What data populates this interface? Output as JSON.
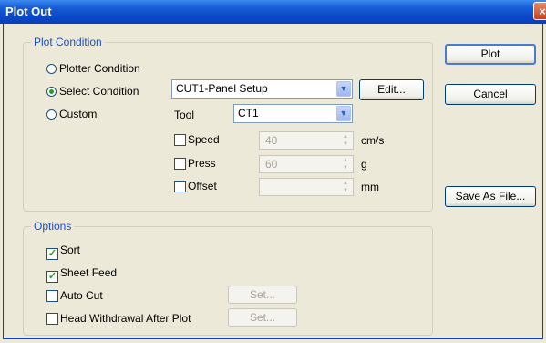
{
  "window": {
    "title": "Plot Out",
    "close_symbol": "×"
  },
  "plot_condition": {
    "legend": "Plot Condition",
    "radios": [
      {
        "label": "Plotter Condition",
        "selected": false
      },
      {
        "label": "Select Condition",
        "selected": true
      },
      {
        "label": "Custom",
        "selected": false
      }
    ],
    "condition_select": {
      "value": "CUT1-Panel Setup"
    },
    "edit_label": "Edit...",
    "tool_label": "Tool",
    "tool_select": {
      "value": "CT1"
    },
    "speed": {
      "label": "Speed",
      "value": "40",
      "unit": "cm/s",
      "checked": false
    },
    "press": {
      "label": "Press",
      "value": "60",
      "unit": "g",
      "checked": false
    },
    "offset": {
      "label": "Offset",
      "value": "",
      "unit": "mm",
      "checked": false
    }
  },
  "options": {
    "legend": "Options",
    "sort": {
      "label": "Sort",
      "checked": true
    },
    "sheet_feed": {
      "label": "Sheet Feed",
      "checked": true
    },
    "auto_cut": {
      "label": "Auto Cut",
      "checked": false,
      "set_label": "Set..."
    },
    "head_withdrawal": {
      "label": "Head Withdrawal After Plot",
      "checked": false,
      "set_label": "Set..."
    }
  },
  "buttons": {
    "plot": "Plot",
    "cancel": "Cancel",
    "save_as_file": "Save As File..."
  },
  "icons": {
    "check_mark": "✓",
    "dropdown_arrow": "▼",
    "spin_up": "▲",
    "spin_down": "▼"
  },
  "colors": {
    "titlebar": "#0a48c8",
    "legend_text": "#1d4fc8",
    "dialog_bg": "#ece9d8"
  }
}
